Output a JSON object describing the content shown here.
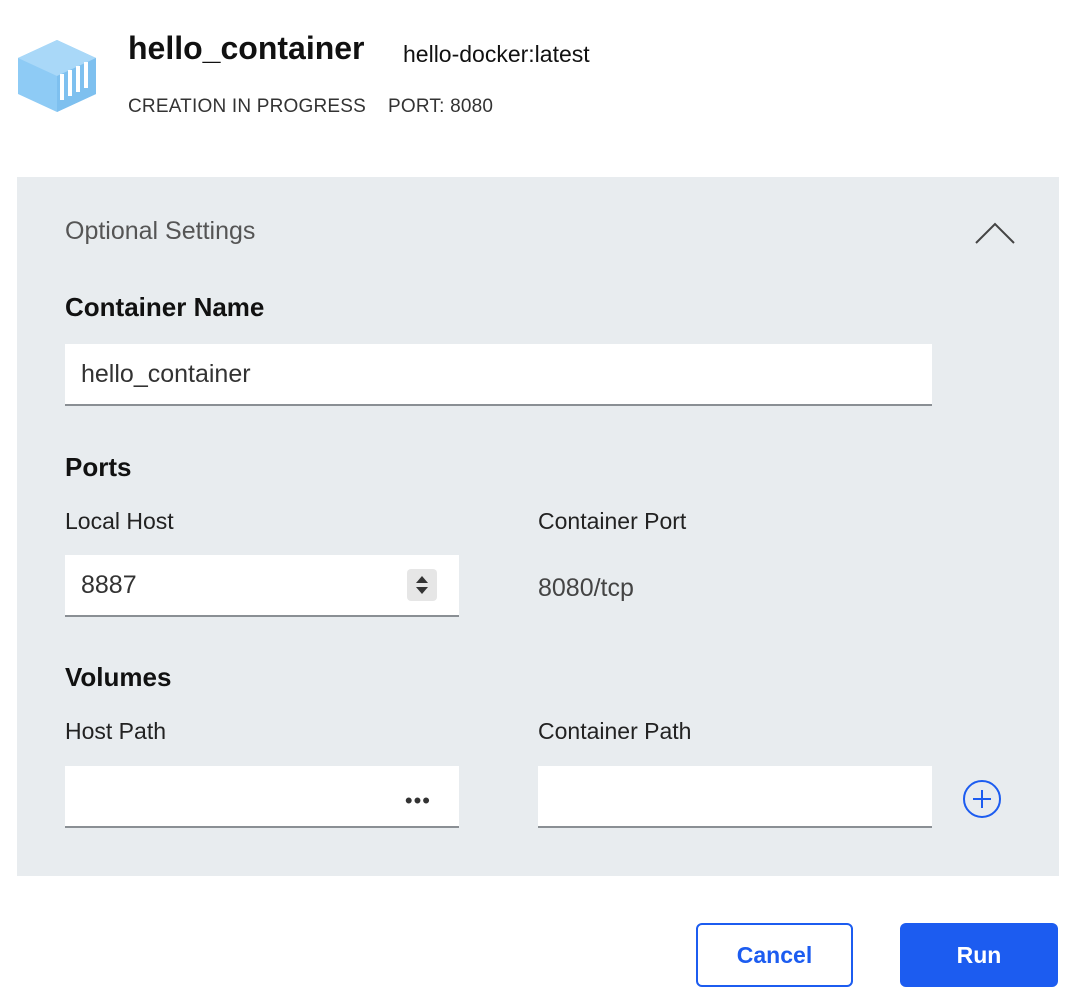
{
  "header": {
    "container_name": "hello_container",
    "image_tag": "hello-docker:latest",
    "status": "CREATION IN PROGRESS",
    "port_info": "PORT: 8080",
    "logo_icon": "docker-container-cube-icon",
    "logo_color": "#8ecbf5"
  },
  "optional_settings": {
    "title": "Optional Settings",
    "collapse_icon": "chevron-up-icon",
    "container_name_section": {
      "label": "Container Name",
      "value": "hello_container"
    },
    "ports_section": {
      "label": "Ports",
      "local_host_label": "Local Host",
      "local_host_value": "8887",
      "container_port_label": "Container Port",
      "container_port_value": "8080/tcp"
    },
    "volumes_section": {
      "label": "Volumes",
      "host_path_label": "Host Path",
      "host_path_value": "",
      "browse_label": "•••",
      "container_path_label": "Container Path",
      "container_path_value": "",
      "add_icon": "plus-circle-icon"
    }
  },
  "actions": {
    "cancel_label": "Cancel",
    "run_label": "Run"
  },
  "colors": {
    "accent": "#1c5cf0",
    "panel_background": "#e8ecef"
  }
}
